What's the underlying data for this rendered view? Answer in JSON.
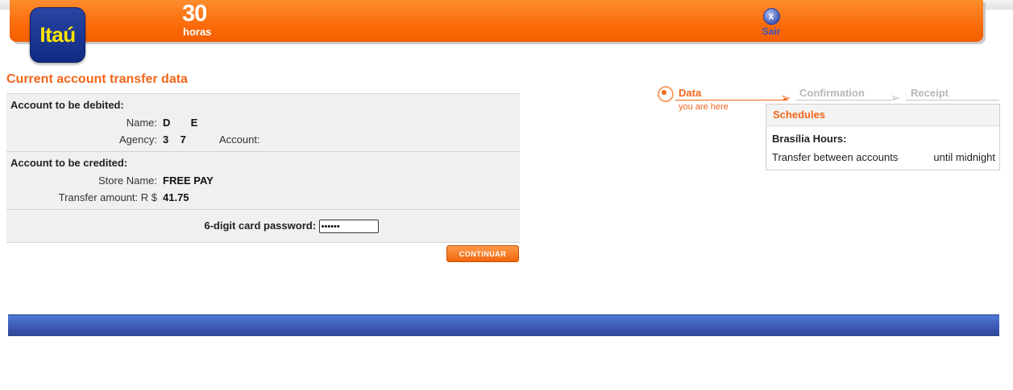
{
  "header": {
    "logo_text": "Itaú",
    "hours_number": "30",
    "hours_word": "horas",
    "logout_label": "Sair",
    "logout_icon_glyph": "x"
  },
  "page": {
    "title": "Current account transfer data"
  },
  "debit": {
    "heading": "Account to be debited:",
    "name_label": "Name:",
    "name_value": "D       E",
    "agency_label": "Agency:",
    "agency_value": "3    7",
    "account_label": "Account:"
  },
  "credit": {
    "heading": "Account to be credited:",
    "store_label": "Store Name:",
    "store_value": "FREE PAY",
    "amount_label": "Transfer amount: R $",
    "amount_value": "41.75"
  },
  "password": {
    "label": "6-digit card password:",
    "value": "••••••"
  },
  "continue_button": "CONTINUAR",
  "steps": {
    "step1": "Data",
    "step1_note": "you are here",
    "step2": "Confirmation",
    "step3": "Receipt"
  },
  "schedules": {
    "title": "Schedules",
    "subtitle": "Brasília Hours:",
    "row_label": "Transfer between accounts",
    "row_value": "until midnight"
  },
  "colors": {
    "brand_orange": "#fb6b0a",
    "brand_blue": "#0f2b82",
    "logo_yellow": "#ffe500",
    "footer_blue": "#3c5ab4"
  }
}
